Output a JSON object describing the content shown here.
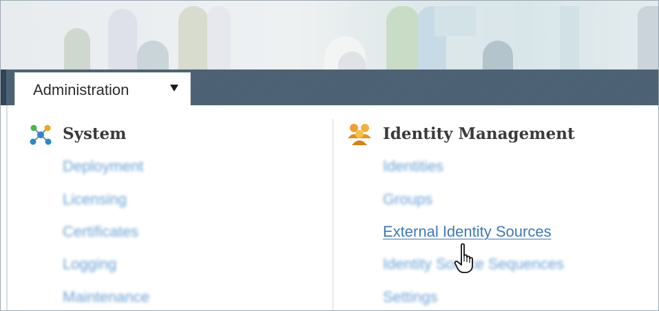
{
  "tab": {
    "label": "Administration",
    "caret_icon": "chevron-down-icon"
  },
  "sections": {
    "system": {
      "title": "System",
      "icon": "network-nodes-icon",
      "links": [
        "Deployment",
        "Licensing",
        "Certificates",
        "Logging",
        "Maintenance"
      ]
    },
    "identity": {
      "title": "Identity Management",
      "icon": "users-group-icon",
      "links": [
        "Identities",
        "Groups",
        "External Identity Sources",
        "Identity Source Sequences",
        "Settings"
      ]
    }
  },
  "colors": {
    "nav_bar": "#4c6274",
    "link": "#5d97cf",
    "active_link": "#3f78b8"
  },
  "cursor": "hand-pointer-icon"
}
